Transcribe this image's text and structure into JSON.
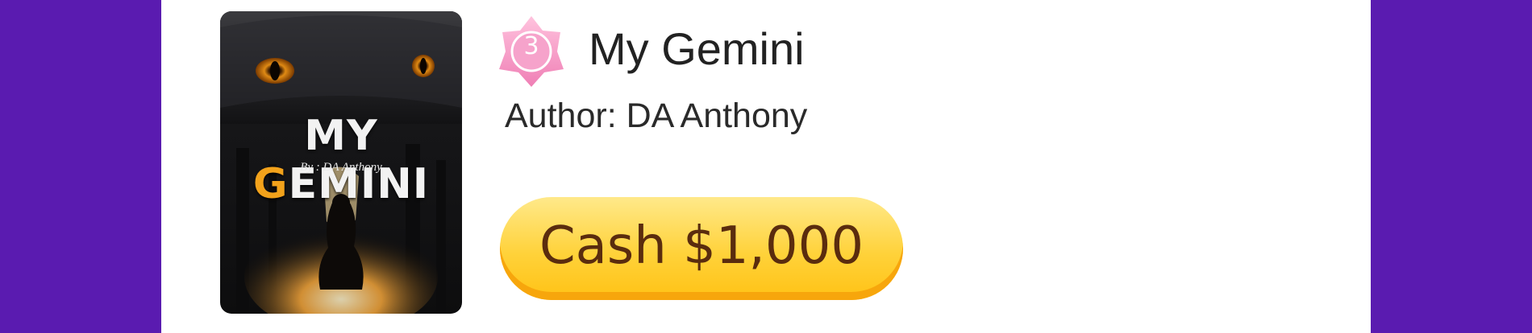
{
  "book": {
    "title": "My Gemini",
    "author_line": "Author: DA Anthony",
    "rank_badge": "3",
    "cover": {
      "title_part1": "MY ",
      "title_highlight": "G",
      "title_part2": "EMINI",
      "byline": "By : DA Anthony"
    }
  },
  "actions": {
    "cash_label": "Cash $1,000"
  },
  "colors": {
    "background": "#5a1bb0",
    "card": "#ffffff",
    "button_yellow": "#ffd23a",
    "button_text": "#5a2c0e",
    "badge_pink": "#f48fc0",
    "cover_accent": "#f2a21b"
  },
  "icons": {
    "rank_badge": "star-badge-icon"
  }
}
